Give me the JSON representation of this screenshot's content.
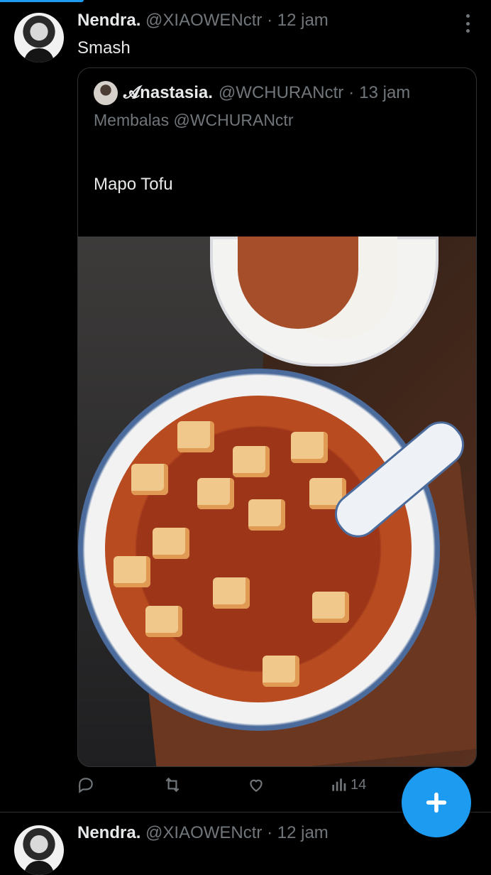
{
  "colors": {
    "background": "#000000",
    "text": "#e7e9ea",
    "muted": "#71767b",
    "accent": "#1d9bf0",
    "border": "#2f3336"
  },
  "tweets": [
    {
      "display_name": "Nendra.",
      "handle": "@XIAOWENctr",
      "dot": "·",
      "time": "12 jam",
      "text": "Smash",
      "quote": {
        "display_name": "𝓐nastasia.",
        "handle": "@WCHURANctr",
        "dot": "·",
        "time": "13 jam",
        "reply_to": "Membalas @WCHURANctr",
        "text": "Mapo Tofu"
      },
      "actions": {
        "views": "14"
      }
    },
    {
      "display_name": "Nendra.",
      "handle": "@XIAOWENctr",
      "dot": "·",
      "time": "12 jam"
    }
  ],
  "icons": [
    "more-icon",
    "reply-icon",
    "retweet-icon",
    "like-icon",
    "views-icon",
    "plus-icon"
  ]
}
